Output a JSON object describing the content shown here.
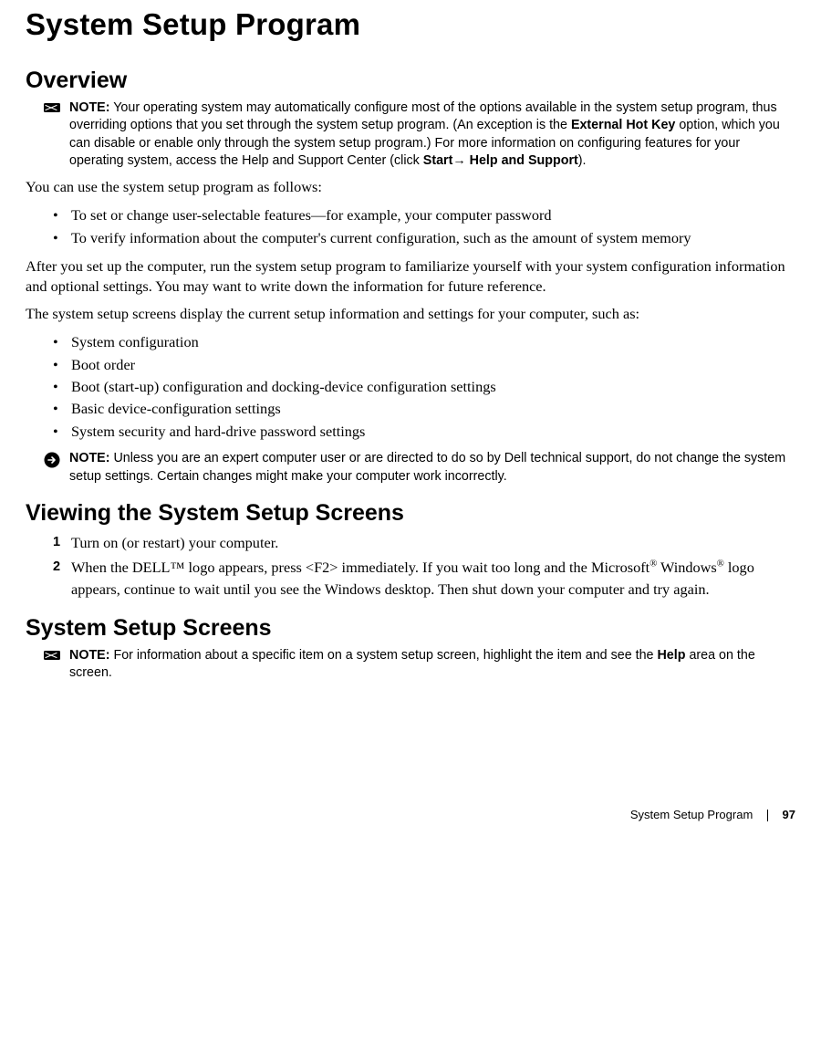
{
  "title": "System Setup Program",
  "sections": {
    "overview": {
      "heading": "Overview",
      "note1": {
        "label": "NOTE:",
        "pre": " Your operating system may automatically configure most of the options available in the system setup program, thus overriding options that you set through the system setup program. (An exception is the ",
        "bold1": "External Hot Key",
        "mid": " option, which you can disable or enable only through the system setup program.) For more information on configuring features for your operating system, access the Help and Support Center (click ",
        "bold2": "Start",
        "arrow": "→ ",
        "bold3": "Help and Support",
        "end": ")."
      },
      "para1": "You can use the system setup program as follows:",
      "bulletsA": [
        "To set or change user-selectable features—for example, your computer password",
        "To verify information about the computer's current configuration, such as the amount of system memory"
      ],
      "para2": "After you set up the computer, run the system setup program to familiarize yourself with your system configuration information and optional settings. You may want to write down the information for future reference.",
      "para3": "The system setup screens display the current setup information and settings for your computer, such as:",
      "bulletsB": [
        "System configuration",
        "Boot order",
        "Boot (start-up) configuration and docking-device configuration settings",
        "Basic device-configuration settings",
        "System security and hard-drive password settings"
      ],
      "note2": {
        "label": "NOTE:",
        "text": " Unless you are an expert computer user or are directed to do so by Dell technical support, do not change the system setup settings. Certain changes might make your computer work incorrectly."
      }
    },
    "viewing": {
      "heading": "Viewing the System Setup Screens",
      "steps": {
        "s1": "Turn on (or restart) your computer.",
        "s2_pre": "When the DELL™ logo appears, press <F2> immediately. If you wait too long and the Microsoft",
        "s2_reg1": "®",
        "s2_mid": " Windows",
        "s2_reg2": "®",
        "s2_post": " logo appears, continue to wait until you see the Windows desktop. Then shut down your computer and try again."
      }
    },
    "screens": {
      "heading": "System Setup Screens",
      "note": {
        "label": "NOTE:",
        "pre": " For information about a specific item on a system setup screen, highlight the item and see the ",
        "bold": "Help",
        "post": " area on the screen."
      }
    }
  },
  "footer": {
    "section": "System Setup Program",
    "page": "97"
  }
}
